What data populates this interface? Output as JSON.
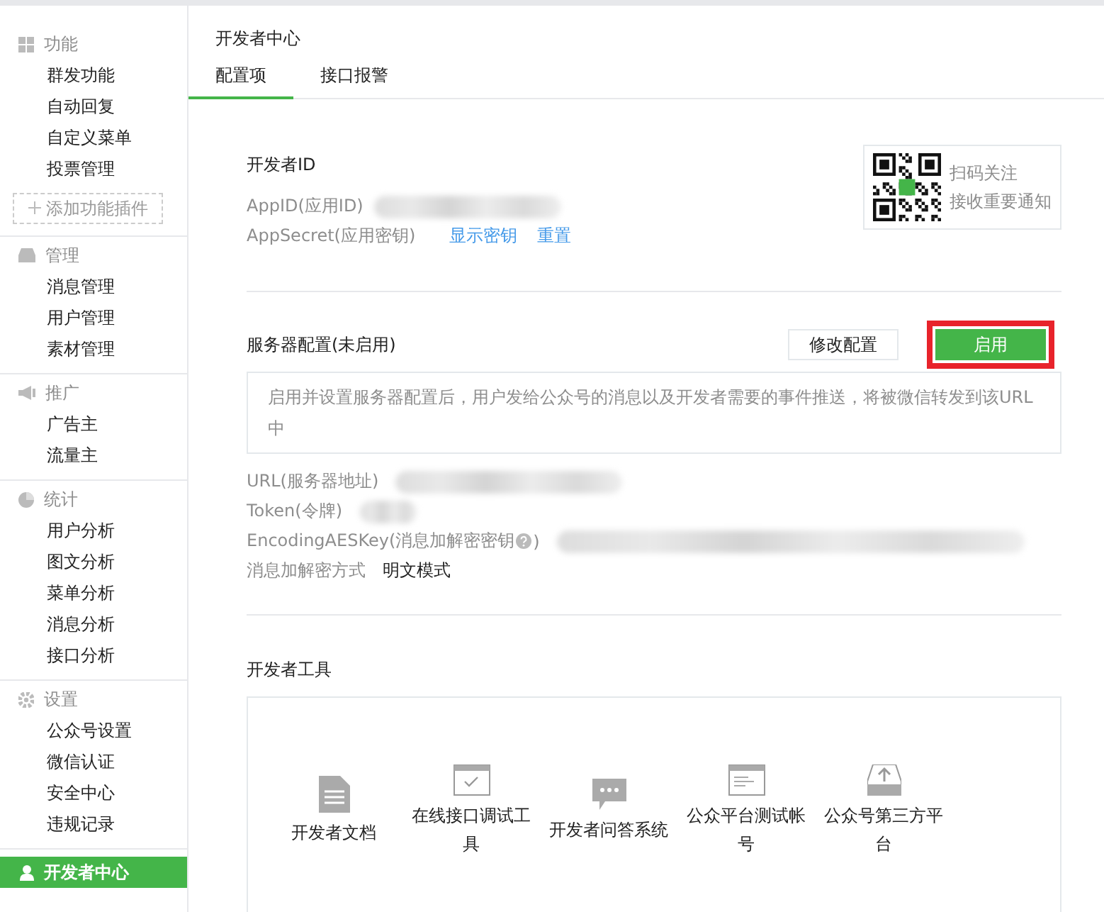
{
  "sidebar": {
    "groups": [
      {
        "title": "功能",
        "items": [
          {
            "label": "群发功能",
            "selected": false
          },
          {
            "label": "自动回复",
            "selected": false
          },
          {
            "label": "自定义菜单",
            "selected": false
          },
          {
            "label": "投票管理",
            "selected": false
          }
        ],
        "add_button": "添加功能插件"
      },
      {
        "title": "管理",
        "items": [
          {
            "label": "消息管理",
            "selected": false
          },
          {
            "label": "用户管理",
            "selected": false
          },
          {
            "label": "素材管理",
            "selected": false
          }
        ]
      },
      {
        "title": "推广",
        "items": [
          {
            "label": "广告主",
            "selected": false
          },
          {
            "label": "流量主",
            "selected": false
          }
        ]
      },
      {
        "title": "统计",
        "items": [
          {
            "label": "用户分析",
            "selected": false
          },
          {
            "label": "图文分析",
            "selected": false
          },
          {
            "label": "菜单分析",
            "selected": false
          },
          {
            "label": "消息分析",
            "selected": false
          },
          {
            "label": "接口分析",
            "selected": false
          }
        ]
      },
      {
        "title": "设置",
        "items": [
          {
            "label": "公众号设置",
            "selected": false
          },
          {
            "label": "微信认证",
            "selected": false
          },
          {
            "label": "安全中心",
            "selected": false
          },
          {
            "label": "违规记录",
            "selected": false
          }
        ]
      }
    ],
    "nav_link": {
      "label": "开发者中心",
      "selected": true
    }
  },
  "page_title": "开发者中心",
  "tabs": [
    {
      "label": "配置项",
      "selected": true
    },
    {
      "label": "接口报警",
      "selected": false
    }
  ],
  "developer_id": {
    "title": "开发者ID",
    "rows": [
      {
        "label": "AppID(应用ID)"
      },
      {
        "label": "AppSecret(应用密钥)",
        "links": [
          "显示密钥",
          "重置"
        ]
      }
    ]
  },
  "qr_card": {
    "lines": [
      "扫码关注",
      "接收重要通知"
    ]
  },
  "server_config": {
    "title": "服务器配置(未启用)",
    "buttons": [
      {
        "label": "修改配置",
        "kind": "secondary",
        "highlighted": false
      },
      {
        "label": "启用",
        "kind": "primary",
        "highlighted": true
      }
    ],
    "notice": "启用并设置服务器配置后，用户发给公众号的消息以及开发者需要的事件推送，将被微信转发到该URL中",
    "rows": [
      {
        "label": "URL(服务器地址)",
        "kind": "redacted"
      },
      {
        "label": "Token(令牌)",
        "kind": "redacted"
      },
      {
        "label": "EncodingAESKey(消息加解密密钥",
        "help": true,
        "suffix": ")",
        "kind": "redacted"
      },
      {
        "label": "消息加解密方式",
        "kind": "text",
        "value": "明文模式"
      }
    ]
  },
  "tools": {
    "title": "开发者工具",
    "items": [
      {
        "label": "开发者文档",
        "kind": "document"
      },
      {
        "label": "在线接口调试工具",
        "kind": "window-check"
      },
      {
        "label": "开发者问答系统",
        "kind": "chat"
      },
      {
        "label": "公众平台测试帐号",
        "kind": "window-lines"
      },
      {
        "label": "公众号第三方平台",
        "kind": "upload"
      }
    ]
  }
}
